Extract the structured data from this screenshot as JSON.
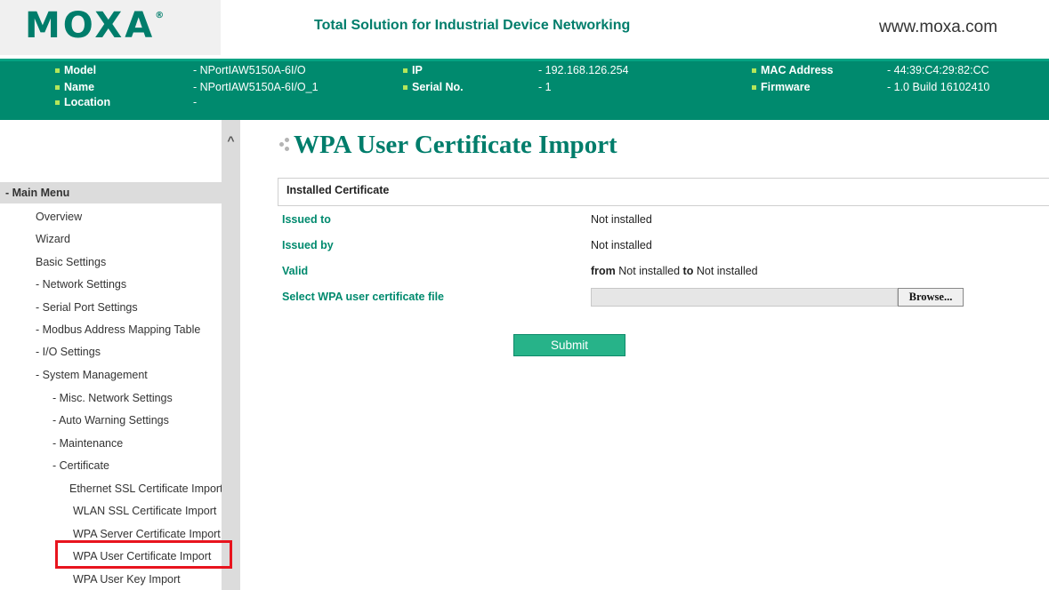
{
  "header": {
    "logo": "MOXA",
    "logo_mark": "®",
    "tagline": "Total Solution for Industrial Device Networking",
    "website": "www.moxa.com"
  },
  "info": {
    "model_label": "Model",
    "model_value": "- NPortIAW5150A-6I/O",
    "name_label": "Name",
    "name_value": "- NPortIAW5150A-6I/O_1",
    "location_label": "Location",
    "location_value": "-",
    "ip_label": "IP",
    "ip_value": "- 192.168.126.254",
    "serial_label": "Serial No.",
    "serial_value": "- 1",
    "mac_label": "MAC Address",
    "mac_value": "- 44:39:C4:29:82:CC",
    "firmware_label": "Firmware",
    "firmware_value": "- 1.0 Build 16102410",
    "bullet_color": "#b4e65a",
    "bar_color": "#008a6e"
  },
  "sidebar": {
    "scroll_up": "^",
    "main_menu": "- Main Menu",
    "items": [
      "Overview",
      "Wizard",
      "Basic Settings",
      "- Network Settings",
      "- Serial Port Settings",
      "- Modbus Address Mapping Table",
      "- I/O Settings",
      "- System Management",
      "- Misc. Network Settings",
      "- Auto Warning Settings",
      "- Maintenance",
      "- Certificate",
      "Ethernet SSL Certificate Import",
      "WLAN SSL Certificate Import",
      "WPA Server Certificate Import",
      "WPA User Certificate Import",
      "WPA User Key Import"
    ],
    "selected_item": "WPA User Certificate Import",
    "highlight_color": "#e8141e"
  },
  "main": {
    "title": "WPA User Certificate Import",
    "section_title": "Installed Certificate",
    "issued_to_label": "Issued to",
    "issued_to_value": "Not installed",
    "issued_by_label": "Issued by",
    "issued_by_value": "Not installed",
    "valid_label": "Valid",
    "valid_from_word": "from",
    "valid_from_value": "Not installed",
    "valid_to_word": "to",
    "valid_to_value": "Not installed",
    "file_label": "Select WPA user certificate file",
    "file_value": "",
    "browse_label": "Browse...",
    "submit_label": "Submit",
    "accent_color": "#007d6b"
  }
}
